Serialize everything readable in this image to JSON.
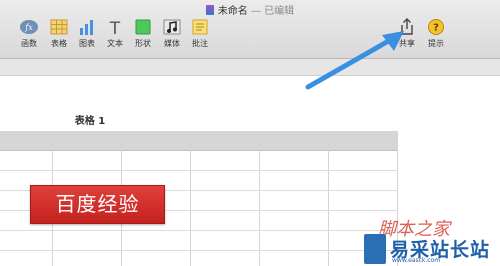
{
  "window": {
    "title": "未命名",
    "separator": " — ",
    "status": "已编辑"
  },
  "toolbar": {
    "items": [
      {
        "label": "函数",
        "icon": "function-icon"
      },
      {
        "label": "表格",
        "icon": "table-icon"
      },
      {
        "label": "图表",
        "icon": "chart-icon"
      },
      {
        "label": "文本",
        "icon": "text-icon"
      },
      {
        "label": "形状",
        "icon": "shape-icon"
      },
      {
        "label": "媒体",
        "icon": "media-icon"
      },
      {
        "label": "批注",
        "icon": "comment-icon"
      }
    ],
    "right_items": [
      {
        "label": "共享",
        "icon": "share-icon"
      },
      {
        "label": "提示",
        "icon": "tips-icon"
      }
    ],
    "function_glyph": "fx",
    "text_glyph": "T",
    "tips_glyph": "?"
  },
  "sheet": {
    "table_title": "表格 1"
  },
  "watermark": {
    "red_box_text": "百度经验",
    "script_text": "脚本之家",
    "logo_text": "易采站长站",
    "logo_url": "www.easck.com"
  },
  "colors": {
    "accent_arrow": "#3b8fe0",
    "watermark_red": "#d6302b",
    "logo_blue": "#1f5fa8"
  }
}
